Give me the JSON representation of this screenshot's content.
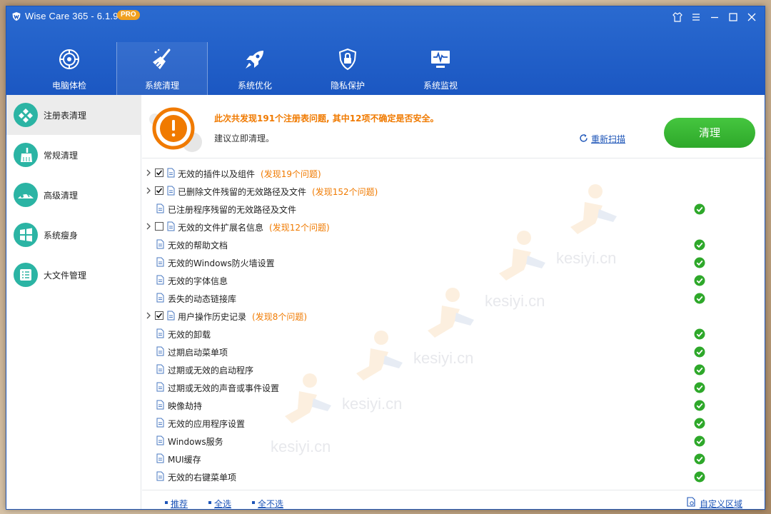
{
  "app": {
    "title": "Wise Care 365 - 6.1.9",
    "badge": "PRO",
    "accent_color": "#1b57c2"
  },
  "window_controls": [
    {
      "name": "skin-icon"
    },
    {
      "name": "menu-icon"
    },
    {
      "name": "minimize-icon"
    },
    {
      "name": "maximize-icon"
    },
    {
      "name": "close-icon"
    }
  ],
  "nav": {
    "active": "系统清理",
    "items": [
      {
        "label": "电脑体检",
        "icon": "target-icon"
      },
      {
        "label": "系统清理",
        "icon": "broom-icon"
      },
      {
        "label": "系统优化",
        "icon": "rocket-icon"
      },
      {
        "label": "隐私保护",
        "icon": "lock-shield-icon"
      },
      {
        "label": "系统监视",
        "icon": "monitor-pulse-icon"
      }
    ]
  },
  "sidebar": {
    "active": "注册表清理",
    "items": [
      {
        "label": "注册表清理",
        "icon": "registry-icon"
      },
      {
        "label": "常规清理",
        "icon": "broom-icon"
      },
      {
        "label": "高级清理",
        "icon": "disk-icon"
      },
      {
        "label": "系统瘦身",
        "icon": "windows-icon"
      },
      {
        "label": "大文件管理",
        "icon": "file-list-icon"
      }
    ]
  },
  "summary": {
    "title": "此次共发现191个注册表问题, 其中12项不确定是否安全。",
    "subtitle": "建议立即清理。",
    "rescan_label": "重新扫描",
    "clean_button": "清理",
    "warn_color": "#f07a00",
    "ok_color": "#2ea82a"
  },
  "list": {
    "items": [
      {
        "label": "无效的插件以及组件",
        "count": "(发现19个问题)",
        "expandable": true,
        "checked": true,
        "ok": false,
        "icon": "plugin-icon"
      },
      {
        "label": "已删除文件残留的无效路径及文件",
        "count": "(发现152个问题)",
        "expandable": true,
        "checked": true,
        "ok": false,
        "icon": "folder-icon"
      },
      {
        "label": "已注册程序残留的无效路径及文件",
        "count": "",
        "expandable": false,
        "checked": false,
        "ok": true,
        "icon": "file-icon"
      },
      {
        "label": "无效的文件扩展名信息",
        "count": "(发现12个问题)",
        "expandable": true,
        "checked": false,
        "ok": false,
        "icon": "file-ext-icon"
      },
      {
        "label": "无效的帮助文档",
        "count": "",
        "expandable": false,
        "checked": false,
        "ok": true,
        "icon": "help-doc-icon"
      },
      {
        "label": "无效的Windows防火墙设置",
        "count": "",
        "expandable": false,
        "checked": false,
        "ok": true,
        "icon": "firewall-icon"
      },
      {
        "label": "无效的字体信息",
        "count": "",
        "expandable": false,
        "checked": false,
        "ok": true,
        "icon": "font-icon"
      },
      {
        "label": "丢失的动态链接库",
        "count": "",
        "expandable": false,
        "checked": false,
        "ok": true,
        "icon": "link-icon"
      },
      {
        "label": "用户操作历史记录",
        "count": "(发现8个问题)",
        "expandable": true,
        "checked": true,
        "ok": false,
        "icon": "history-icon"
      },
      {
        "label": "无效的卸载",
        "count": "",
        "expandable": false,
        "checked": false,
        "ok": true,
        "icon": "uninstall-icon"
      },
      {
        "label": "过期启动菜单项",
        "count": "",
        "expandable": false,
        "checked": false,
        "ok": true,
        "icon": "start-menu-icon"
      },
      {
        "label": "过期或无效的启动程序",
        "count": "",
        "expandable": false,
        "checked": false,
        "ok": true,
        "icon": "startup-icon"
      },
      {
        "label": "过期或无效的声音或事件设置",
        "count": "",
        "expandable": false,
        "checked": false,
        "ok": true,
        "icon": "sound-icon"
      },
      {
        "label": "映像劫持",
        "count": "",
        "expandable": false,
        "checked": false,
        "ok": true,
        "icon": "hijack-icon"
      },
      {
        "label": "无效的应用程序设置",
        "count": "",
        "expandable": false,
        "checked": false,
        "ok": true,
        "icon": "warning-icon"
      },
      {
        "label": "Windows服务",
        "count": "",
        "expandable": false,
        "checked": false,
        "ok": true,
        "icon": "services-icon"
      },
      {
        "label": "MUI缓存",
        "count": "",
        "expandable": false,
        "checked": false,
        "ok": true,
        "icon": "cache-icon"
      },
      {
        "label": "无效的右键菜单项",
        "count": "",
        "expandable": false,
        "checked": false,
        "ok": true,
        "icon": "mouse-icon"
      }
    ]
  },
  "watermark": "kesiyi.cn",
  "footer": {
    "recommend": "推荐",
    "select_all": "全选",
    "select_none": "全不选",
    "custom_area": "自定义区域"
  }
}
